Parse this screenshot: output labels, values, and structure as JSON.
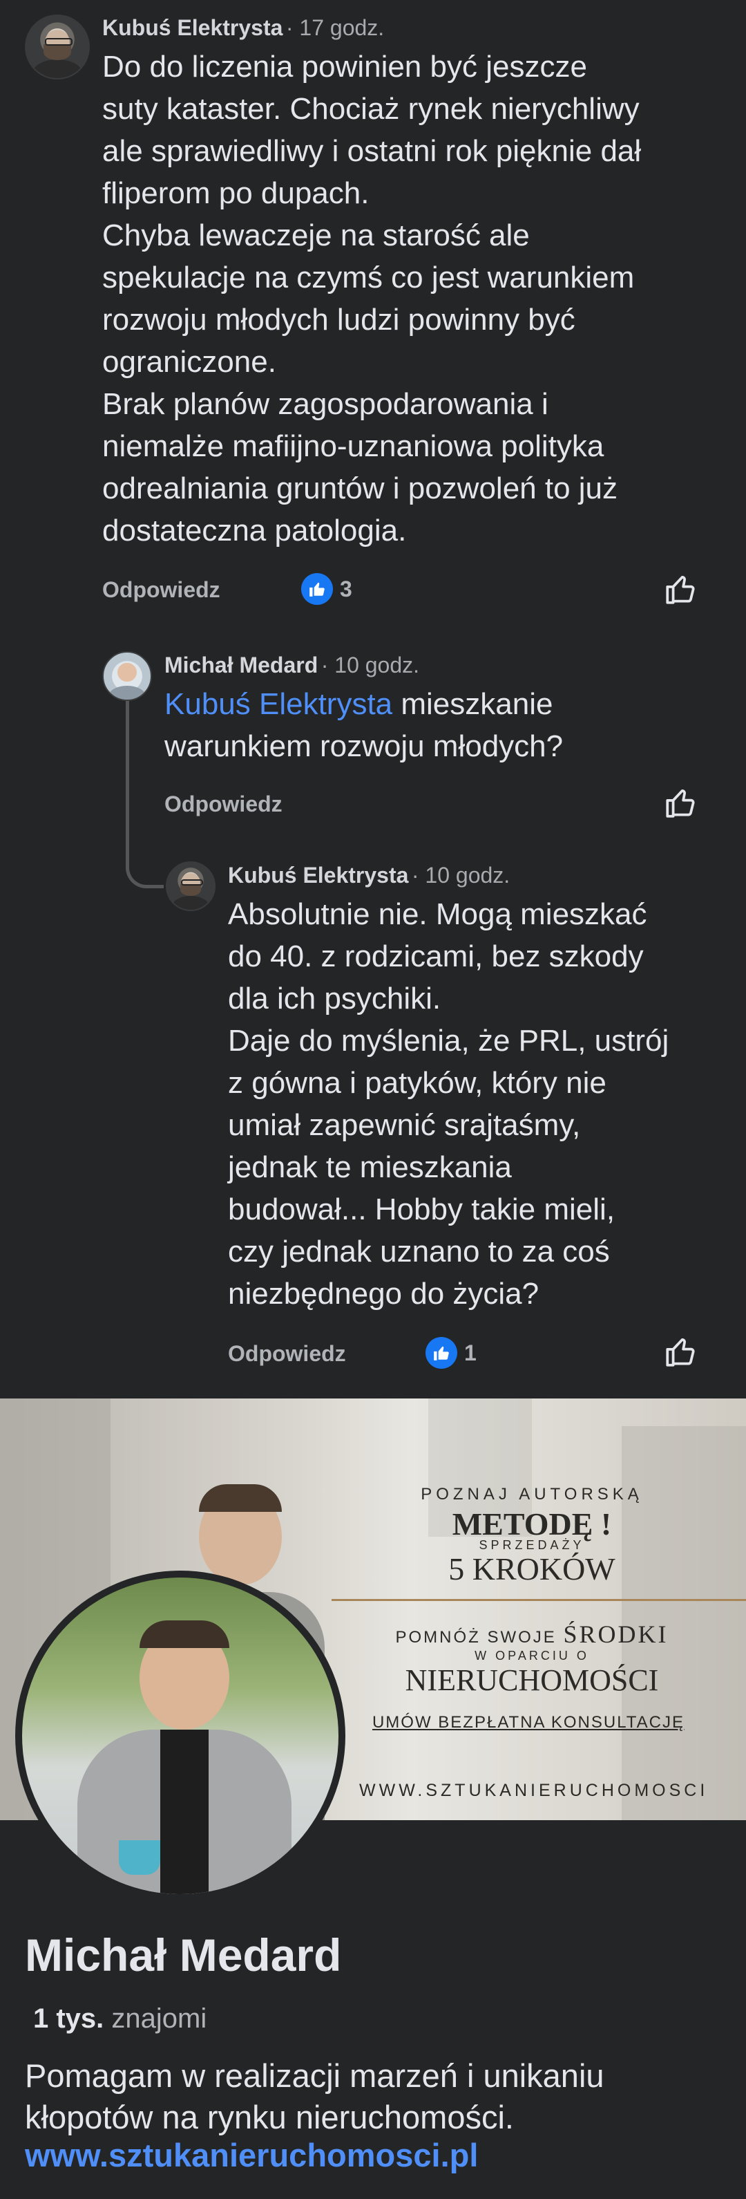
{
  "comments": [
    {
      "author": "Kubuś Elektrysta",
      "time": "· 17 godz.",
      "text": "Do do liczenia powinien być jeszcze\nsuty kataster. Chociaż rynek nierychliwy\nale sprawiedliwy i ostatni rok pięknie dał\nfliperom po dupach.\nChyba lewaczeje na starość ale\nspekulacje na czymś co jest warunkiem\nrozwoju młodych ludzi powinny być\nograniczone.\nBrak planów zagospodarowania i\nniemalże mafiijno-uznaniowa polityka\nodrealniania gruntów i pozwoleń to już\ndostateczna patologia.",
      "reply_label": "Odpowiedz",
      "like_count": "3"
    },
    {
      "author": "Michał Medard",
      "time": "· 10 godz.",
      "mention": "Kubuś Elektrysta",
      "text_after_mention": " mieszkanie",
      "text_rest": "warunkiem rozwoju młodych?",
      "reply_label": "Odpowiedz"
    },
    {
      "author": "Kubuś Elektrysta",
      "time": "· 10 godz.",
      "text": "Absolutnie nie. Mogą mieszkać\ndo 40. z rodzicami, bez szkody\ndla ich psychiki.\nDaje do myślenia, że PRL, ustrój\nz gówna i patyków, który nie\numiał zapewnić srajtaśmy,\njednak te mieszkania\nbudował... Hobby takie mieli,\nczy jednak uznano to za coś\nniezbędnego do życia?",
      "reply_label": "Odpowiedz",
      "like_count": "1"
    }
  ],
  "banner": {
    "line1": "POZNAJ AUTORSKĄ",
    "line2": "METODĘ !",
    "line3": "SPRZEDAŻY",
    "line4": "5 KROKÓW",
    "line5a": "POMNÓŻ SWOJE",
    "line5b": "ŚRODKI",
    "line6": "W OPARCIU O",
    "line7": "NIERUCHOMOŚCI",
    "line8": "UMÓW BEZPŁATNA KONSULTACJĘ",
    "line9": "WWW.SZTUKANIERUCHOMOSCI"
  },
  "profile": {
    "name": "Michał Medard",
    "friends_count": "1 tys.",
    "friends_label": "znajomi",
    "bio": "Pomagam w realizacji marzeń i unikaniu\nkłopotów na rynku nieruchomości.",
    "link": "www.sztukanieruchomosci.pl"
  },
  "colors": {
    "background": "#242526",
    "accent": "#4f8ff7",
    "like": "#1877f2"
  },
  "icons": [
    "like-icon",
    "like-outline-icon"
  ]
}
